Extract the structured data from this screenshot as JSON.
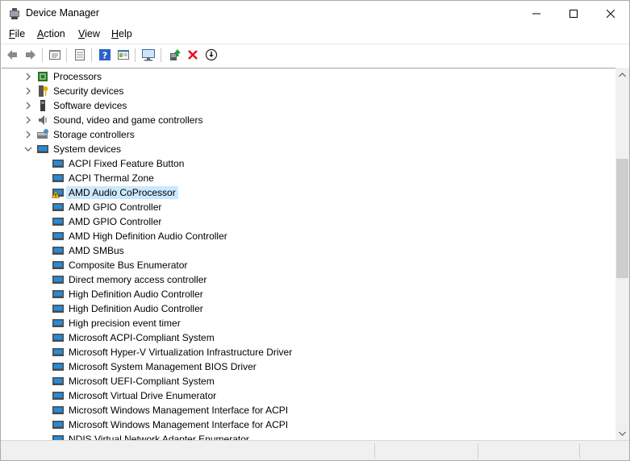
{
  "window": {
    "title": "Device Manager",
    "icon": "device-manager-icon",
    "controls": [
      "minimize",
      "maximize",
      "close"
    ]
  },
  "menu": [
    {
      "label": "File",
      "accel": "F",
      "rest": "ile"
    },
    {
      "label": "Action",
      "accel": "A",
      "rest": "ction"
    },
    {
      "label": "View",
      "accel": "V",
      "rest": "iew"
    },
    {
      "label": "Help",
      "accel": "H",
      "rest": "elp"
    }
  ],
  "toolbar": {
    "buttons": [
      "back-icon",
      "forward-icon",
      "properties-icon",
      "device-list-icon",
      "help-icon",
      "view-resources-icon",
      "scan-hardware-icon",
      "update-driver-icon",
      "uninstall-icon",
      "disable-device-icon"
    ]
  },
  "colors": {
    "selection": "#cce8ff",
    "uninstall_red": "#e81123",
    "accent_blue": "#2a8ad4"
  },
  "tree": {
    "categories": [
      {
        "label": "Processors",
        "icon": "processor-icon",
        "expanded": false
      },
      {
        "label": "Security devices",
        "icon": "security-key-icon",
        "expanded": false
      },
      {
        "label": "Software devices",
        "icon": "software-device-icon",
        "expanded": false
      },
      {
        "label": "Sound, video and game controllers",
        "icon": "speaker-icon",
        "expanded": false
      },
      {
        "label": "Storage controllers",
        "icon": "storage-controller-icon",
        "expanded": false
      },
      {
        "label": "System devices",
        "icon": "system-device-icon",
        "expanded": true
      }
    ],
    "system_devices": [
      {
        "label": "ACPI Fixed Feature Button",
        "warning": false,
        "selected": false
      },
      {
        "label": "ACPI Thermal Zone",
        "warning": false,
        "selected": false
      },
      {
        "label": "AMD Audio CoProcessor",
        "warning": true,
        "selected": true
      },
      {
        "label": "AMD GPIO Controller",
        "warning": false,
        "selected": false
      },
      {
        "label": "AMD GPIO Controller",
        "warning": false,
        "selected": false
      },
      {
        "label": "AMD High Definition Audio Controller",
        "warning": false,
        "selected": false
      },
      {
        "label": "AMD SMBus",
        "warning": false,
        "selected": false
      },
      {
        "label": "Composite Bus Enumerator",
        "warning": false,
        "selected": false
      },
      {
        "label": "Direct memory access controller",
        "warning": false,
        "selected": false
      },
      {
        "label": "High Definition Audio Controller",
        "warning": false,
        "selected": false
      },
      {
        "label": "High Definition Audio Controller",
        "warning": false,
        "selected": false
      },
      {
        "label": "High precision event timer",
        "warning": false,
        "selected": false
      },
      {
        "label": "Microsoft ACPI-Compliant System",
        "warning": false,
        "selected": false
      },
      {
        "label": "Microsoft Hyper-V Virtualization Infrastructure Driver",
        "warning": false,
        "selected": false
      },
      {
        "label": "Microsoft System Management BIOS Driver",
        "warning": false,
        "selected": false
      },
      {
        "label": "Microsoft UEFI-Compliant System",
        "warning": false,
        "selected": false
      },
      {
        "label": "Microsoft Virtual Drive Enumerator",
        "warning": false,
        "selected": false
      },
      {
        "label": "Microsoft Windows Management Interface for ACPI",
        "warning": false,
        "selected": false
      },
      {
        "label": "Microsoft Windows Management Interface for ACPI",
        "warning": false,
        "selected": false
      },
      {
        "label": "NDIS Virtual Network Adapter Enumerator",
        "warning": false,
        "selected": false
      }
    ]
  },
  "statusbar": {
    "text": ""
  }
}
